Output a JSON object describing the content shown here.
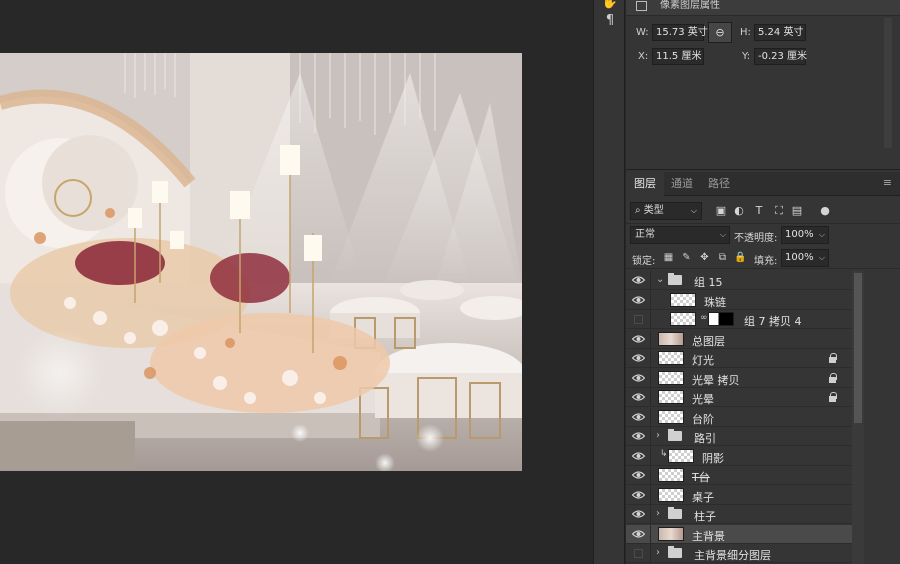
{
  "toolbar_icons": [
    "hand-icon",
    "paragraph-icon"
  ],
  "properties": {
    "title": "像素图层属性",
    "w_label": "W:",
    "w_value": "15.73 英寸",
    "h_label": "H:",
    "h_value": "5.24 英寸",
    "x_label": "X:",
    "x_value": "11.5 厘米",
    "y_label": "Y:",
    "y_value": "-0.23 厘米",
    "link_icon": "link-icon"
  },
  "layers_panel": {
    "tabs": [
      "图层",
      "通道",
      "路径"
    ],
    "active_tab": 0,
    "filter": "类型",
    "blend_mode": "正常",
    "opacity_label": "不透明度:",
    "opacity": "100%",
    "lock_label": "锁定:",
    "fill_label": "填充:",
    "fill": "100%",
    "layers": [
      {
        "name": "组 15",
        "type": "group",
        "expanded": true,
        "visible": true,
        "indent": 0
      },
      {
        "name": "珠链",
        "type": "pixel",
        "visible": true,
        "indent": 1
      },
      {
        "name": "组 7 拷贝 4",
        "type": "masked",
        "visible": false,
        "indent": 1
      },
      {
        "name": "总图层",
        "type": "image",
        "visible": true,
        "indent": 0
      },
      {
        "name": "灯光",
        "type": "pixel",
        "visible": true,
        "locked": true,
        "indent": 0
      },
      {
        "name": "光晕 拷贝",
        "type": "pixel",
        "visible": true,
        "locked": true,
        "indent": 0
      },
      {
        "name": "光晕",
        "type": "pixel",
        "visible": true,
        "locked": true,
        "indent": 0
      },
      {
        "name": "台阶",
        "type": "pixel",
        "visible": true,
        "indent": 0
      },
      {
        "name": "路引",
        "type": "group",
        "expanded": false,
        "visible": true,
        "indent": 0
      },
      {
        "name": "阴影",
        "type": "clipped",
        "visible": true,
        "indent": 0
      },
      {
        "name": "T台",
        "type": "pixel",
        "visible": true,
        "strike": true,
        "indent": 0
      },
      {
        "name": "桌子",
        "type": "pixel",
        "visible": true,
        "indent": 0
      },
      {
        "name": "柱子",
        "type": "group",
        "expanded": false,
        "visible": true,
        "indent": 0
      },
      {
        "name": "主背景",
        "type": "image",
        "visible": true,
        "selected": true,
        "indent": 0
      },
      {
        "name": "主背景细分图层",
        "type": "group",
        "expanded": false,
        "visible": false,
        "indent": 0
      }
    ]
  }
}
